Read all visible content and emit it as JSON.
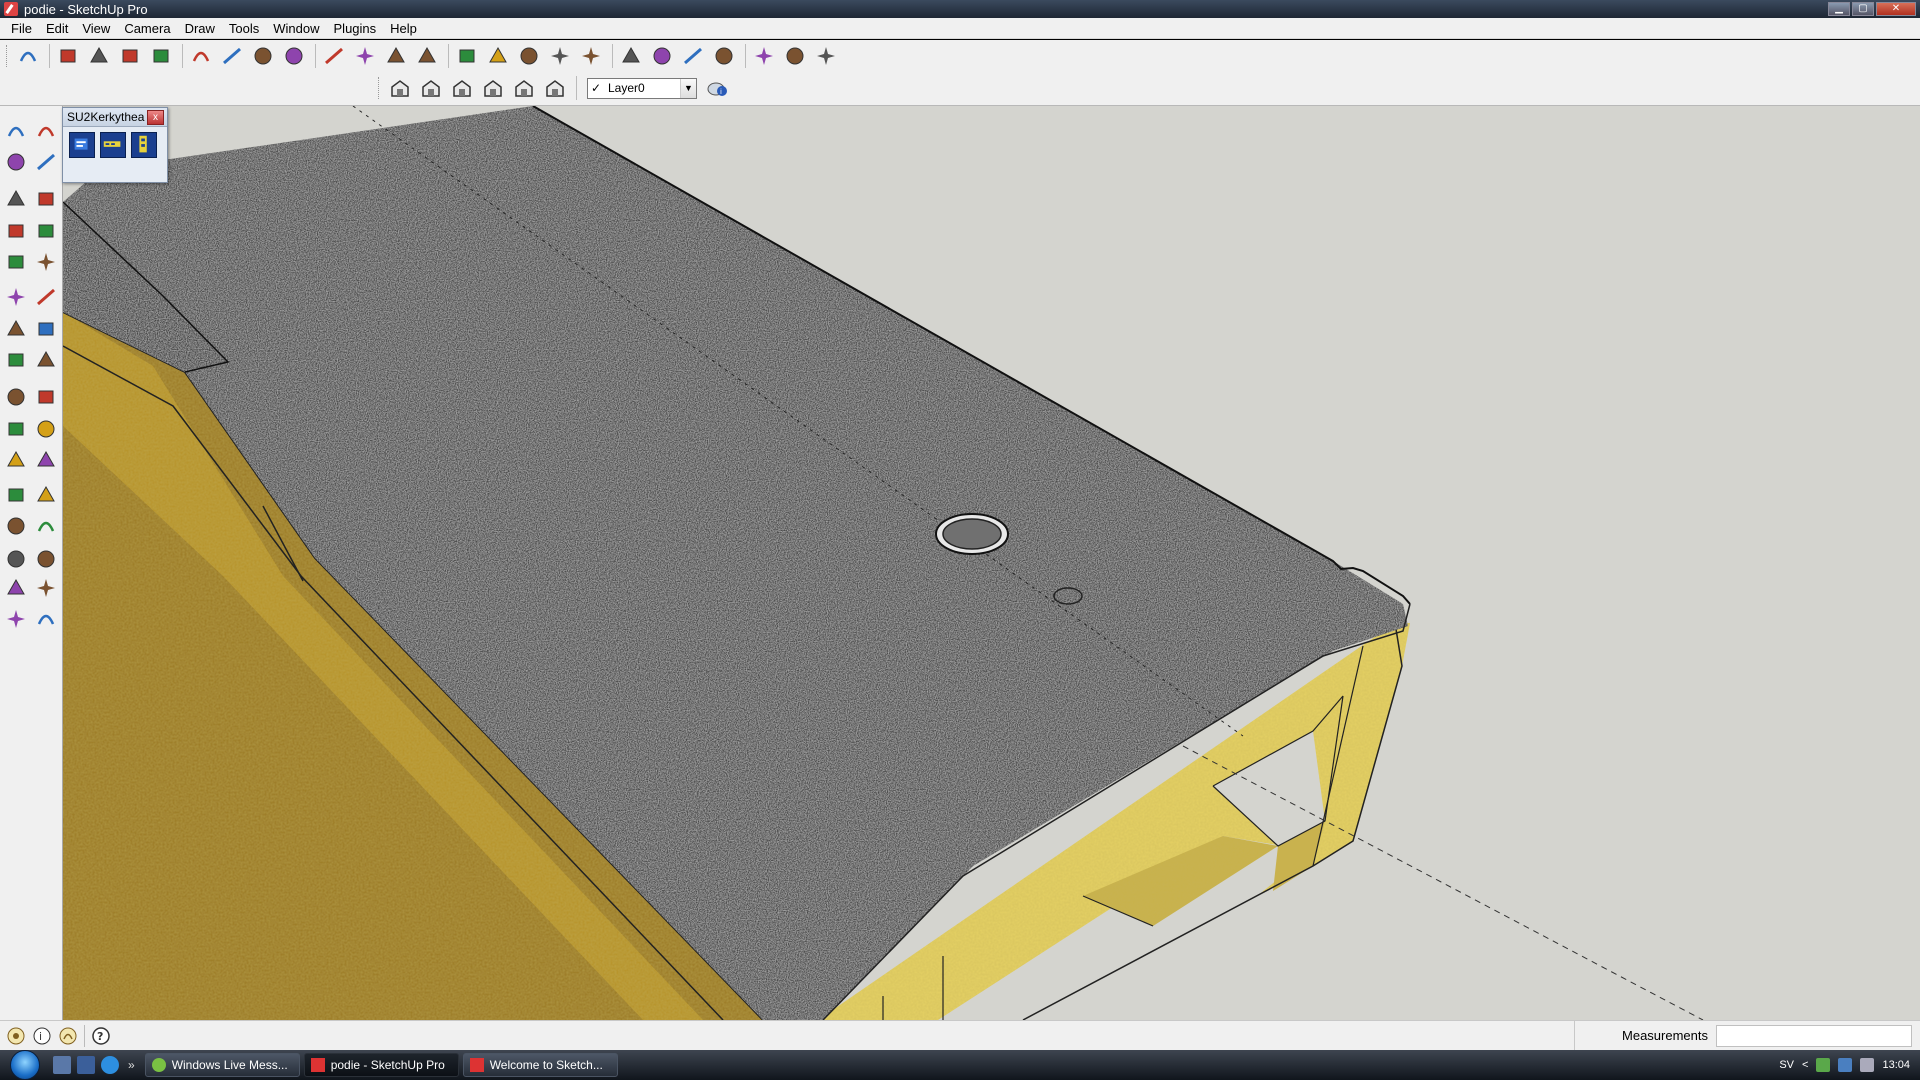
{
  "window": {
    "title": "podie - SketchUp Pro",
    "controls": [
      "minimize",
      "maximize",
      "close"
    ]
  },
  "menu": {
    "items": [
      "File",
      "Edit",
      "View",
      "Camera",
      "Draw",
      "Tools",
      "Window",
      "Plugins",
      "Help"
    ]
  },
  "toolbar_top": {
    "icons": [
      "select-icon",
      "line-pencil-icon",
      "rectangle-icon",
      "circle-icon",
      "arc-icon",
      "make-component-icon",
      "eraser-icon",
      "tape-measure-icon",
      "paint-bucket-icon",
      "push-pull-icon",
      "move-icon",
      "rotate-icon",
      "offset-icon",
      "orbit-icon",
      "pan-icon",
      "zoom-icon",
      "zoom-extents-icon",
      "previous-view-icon",
      "next-view-icon",
      "add-location-icon",
      "toggle-terrain-icon",
      "photo-textures-icon",
      "get-models-icon",
      "share-model-icon",
      "share-component-icon"
    ]
  },
  "toolbar_views": {
    "icons": [
      "iso-view-icon",
      "top-view-icon",
      "front-view-icon",
      "right-view-icon",
      "back-view-icon",
      "left-view-icon"
    ]
  },
  "layer": {
    "checked": "✓",
    "current": "Layer0",
    "manager_icon": "layer-manager-icon"
  },
  "left_toolbar": {
    "icons": [
      "select-icon",
      "make-component-icon",
      "paint-bucket-icon",
      "eraser-icon",
      "rectangle-icon",
      "line-pencil-icon",
      "circle-icon",
      "arc-icon",
      "polygon-icon",
      "freehand-icon",
      "move-icon",
      "push-pull-icon",
      "rotate-icon",
      "follow-me-icon",
      "scale-icon",
      "offset-icon",
      "tape-measure-icon",
      "dimension-icon",
      "protractor-icon",
      "text-icon",
      "axes-icon",
      "3d-text-icon",
      "orbit-icon",
      "pan-icon",
      "zoom-icon",
      "zoom-window-icon",
      "previous-icon",
      "next-icon",
      "position-camera-icon",
      "look-around-icon",
      "walk-icon",
      "section-plane-icon"
    ]
  },
  "palette": {
    "title": "SU2Kerkythea",
    "close": "x",
    "buttons": [
      "kerkythea-export-icon",
      "kerkythea-render-icon",
      "kerkythea-settings-icon"
    ]
  },
  "status": {
    "icons": [
      "geolocation-icon",
      "credits-icon",
      "user-icon",
      "help-icon"
    ],
    "measurements_label": "Measurements",
    "measurements_value": ""
  },
  "taskbar": {
    "quicklaunch": [
      "show-desktop-icon",
      "switch-windows-icon",
      "internet-explorer-icon"
    ],
    "chevron": "»",
    "tasks": [
      {
        "label": "Windows Live Mess...",
        "icon": "messenger-icon",
        "active": false
      },
      {
        "label": "podie - SketchUp Pro",
        "icon": "sketchup-icon",
        "active": true
      },
      {
        "label": "Welcome to Sketch...",
        "icon": "sketchup-icon",
        "active": false
      }
    ],
    "tray": {
      "language": "SV",
      "expand": "<",
      "time": "13:04"
    }
  },
  "colors": {
    "viewport_bg": "#d4d4cf",
    "asphalt": "#4a4a4a",
    "wood_light": "#e6d46a",
    "wood_dark": "#b89a3a"
  }
}
